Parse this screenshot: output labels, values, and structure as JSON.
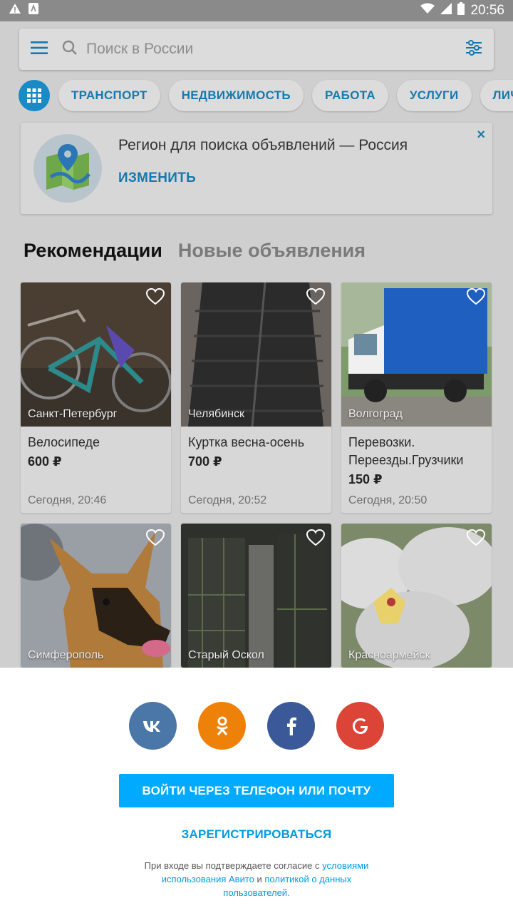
{
  "status_bar": {
    "time": "20:56"
  },
  "search": {
    "placeholder": "Поиск в России"
  },
  "categories": [
    "ТРАНСПОРТ",
    "НЕДВИЖИМОСТЬ",
    "РАБОТА",
    "УСЛУГИ",
    "ЛИЧ"
  ],
  "region_banner": {
    "text": "Регион для поиска объявлений — Россия",
    "action": "ИЗМЕНИТЬ",
    "close": "×"
  },
  "tabs": {
    "active": "Рекомендации",
    "inactive": "Новые объявления"
  },
  "listings": [
    {
      "city": "Санкт-Петербург",
      "title": "Велосипеде",
      "price": "600 ₽",
      "date": "Сегодня, 20:46"
    },
    {
      "city": "Челябинск",
      "title": "Куртка весна-осень",
      "price": "700 ₽",
      "date": "Сегодня, 20:52"
    },
    {
      "city": "Волгоград",
      "title": "Перевозки. Переезды.Грузчики",
      "price": "150 ₽",
      "date": "Сегодня, 20:50"
    },
    {
      "city": "Симферополь"
    },
    {
      "city": "Старый Оскол"
    },
    {
      "city": "Красноармейск"
    }
  ],
  "sheet": {
    "social": [
      {
        "name": "vk",
        "label": "VK",
        "color": "#4a76a8"
      },
      {
        "name": "ok",
        "label": "ok",
        "color": "#ee8208"
      },
      {
        "name": "facebook",
        "label": "f",
        "color": "#3b5998"
      },
      {
        "name": "google",
        "label": "G",
        "color": "#db4437"
      }
    ],
    "login_button": "ВОЙТИ ЧЕРЕЗ ТЕЛЕФОН ИЛИ ПОЧТУ",
    "register": "ЗАРЕГИСТРИРОВАТЬСЯ",
    "legal_prefix": "При входе вы подтверждаете согласие с ",
    "legal_link1": "условиями использования Авито",
    "legal_and": " и ",
    "legal_link2": "политикой о данных пользователей",
    "legal_suffix": "."
  },
  "colors": {
    "accent": "#00aaff",
    "link": "#1679ad"
  }
}
